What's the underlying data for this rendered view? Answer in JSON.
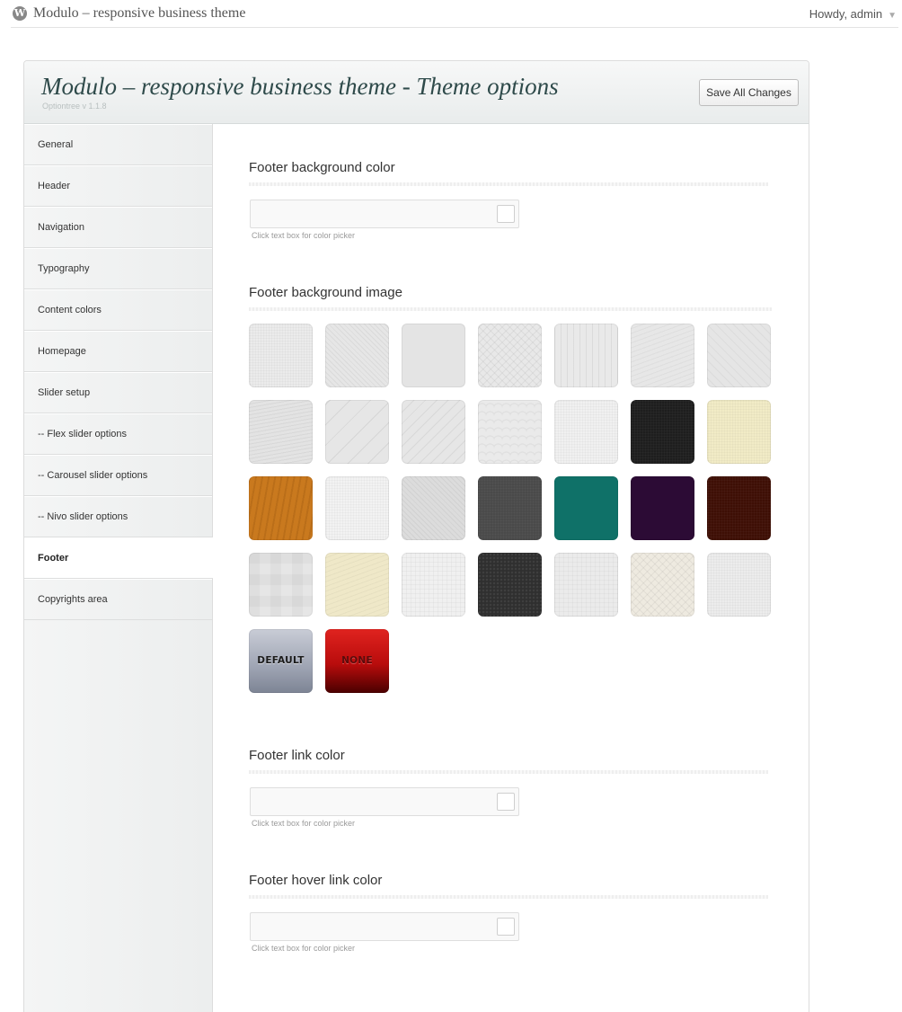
{
  "adminbar": {
    "site_name": "Modulo – responsive business theme",
    "greeting": "Howdy, admin",
    "caret": "▼",
    "logo_glyph": "W"
  },
  "header": {
    "title": "Modulo – responsive business theme - Theme options",
    "version": "Optiontree v 1.1.8",
    "save_label": "Save All Changes"
  },
  "sidebar": {
    "active": "Footer",
    "items": [
      {
        "label": "General"
      },
      {
        "label": "Header"
      },
      {
        "label": "Navigation"
      },
      {
        "label": "Typography"
      },
      {
        "label": "Content colors"
      },
      {
        "label": "Homepage"
      },
      {
        "label": "Slider setup"
      },
      {
        "label": "-- Flex slider options"
      },
      {
        "label": "-- Carousel slider options"
      },
      {
        "label": "-- Nivo slider options"
      },
      {
        "label": "Footer"
      },
      {
        "label": "Copyrights area"
      }
    ]
  },
  "sections": {
    "bg_color": {
      "title": "Footer background color",
      "value": "",
      "hint": "Click text box for color picker"
    },
    "bg_image": {
      "title": "Footer background image",
      "tiles": [
        {
          "name": "pattern-noise-light",
          "color": "#ebebeb",
          "pattern": "noise"
        },
        {
          "name": "pattern-diagonal-fine",
          "color": "#e6e6e6",
          "pattern": "diag-fine"
        },
        {
          "name": "pattern-plain-grey",
          "color": "#e4e4e4",
          "pattern": "plain"
        },
        {
          "name": "pattern-cross-hatch",
          "color": "#e8e8e8",
          "pattern": "cross"
        },
        {
          "name": "pattern-vertical-stripes",
          "color": "#e9e9e9",
          "pattern": "vstripe"
        },
        {
          "name": "pattern-wave-light",
          "color": "#e7e7e7",
          "pattern": "wave"
        },
        {
          "name": "pattern-diagonal-soft",
          "color": "#e5e5e5",
          "pattern": "diag-soft"
        },
        {
          "name": "pattern-wave-dense",
          "color": "#e3e3e3",
          "pattern": "wave-dense"
        },
        {
          "name": "pattern-diagonal-wide",
          "color": "#e6e6e6",
          "pattern": "diag-wide"
        },
        {
          "name": "pattern-diagonal-medium",
          "color": "#e6e6e6",
          "pattern": "diag-med"
        },
        {
          "name": "pattern-scales",
          "color": "#eaeaea",
          "pattern": "scales"
        },
        {
          "name": "pattern-speckle",
          "color": "#f0f0f0",
          "pattern": "noise"
        },
        {
          "name": "pattern-black-leather",
          "color": "#1e1e1e",
          "pattern": "dark"
        },
        {
          "name": "pattern-cream-paper",
          "color": "#f1ebc6",
          "pattern": "noise"
        },
        {
          "name": "pattern-wood",
          "color": "#c9791e",
          "pattern": "wood"
        },
        {
          "name": "pattern-white-texture",
          "color": "#f2f2f2",
          "pattern": "noise"
        },
        {
          "name": "pattern-diagonal-grey",
          "color": "#dcdcdc",
          "pattern": "diag-fine"
        },
        {
          "name": "pattern-dark-grey",
          "color": "#4a4a4a",
          "pattern": "dark"
        },
        {
          "name": "pattern-teal",
          "color": "#0f7168",
          "pattern": "plain"
        },
        {
          "name": "pattern-purple",
          "color": "#2c0b35",
          "pattern": "plain"
        },
        {
          "name": "pattern-brown-leather",
          "color": "#3e0f05",
          "pattern": "dark"
        },
        {
          "name": "pattern-squares-light",
          "color": "#e6e6e6",
          "pattern": "squares"
        },
        {
          "name": "pattern-cream-wave",
          "color": "#efe8c8",
          "pattern": "wave"
        },
        {
          "name": "pattern-grid-faint",
          "color": "#f0f0f0",
          "pattern": "grid"
        },
        {
          "name": "pattern-carbon",
          "color": "#2f2f2f",
          "pattern": "carbon"
        },
        {
          "name": "pattern-linen",
          "color": "#ebebeb",
          "pattern": "grid"
        },
        {
          "name": "pattern-diamond-beige",
          "color": "#eeeae0",
          "pattern": "cross"
        },
        {
          "name": "pattern-stucco",
          "color": "#ececec",
          "pattern": "noise"
        }
      ],
      "default_label": "DEFAULT",
      "none_label": "NONE"
    },
    "link_color": {
      "title": "Footer link color",
      "value": "",
      "hint": "Click text box for color picker"
    },
    "hover_link_color": {
      "title": "Footer hover link color",
      "value": "",
      "hint": "Click text box for color picker"
    }
  }
}
